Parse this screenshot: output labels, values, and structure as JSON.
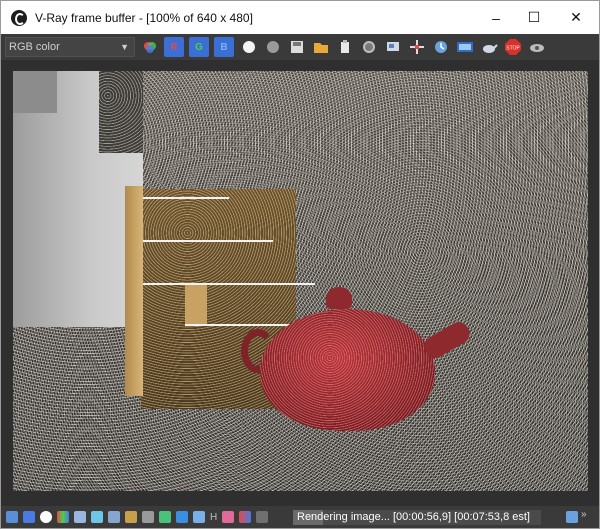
{
  "window": {
    "title": "V-Ray frame buffer - [100% of 640 x 480]",
    "minimize_glyph": "–",
    "maximize_glyph": "☐",
    "close_glyph": "✕"
  },
  "toolbar": {
    "channel_value": "RGB color",
    "red_label": "R",
    "green_label": "G",
    "blue_label": "B",
    "stop_label": "STOP",
    "icons": [
      "color-wheel-icon",
      "red-channel-icon",
      "green-channel-icon",
      "blue-channel-icon",
      "white-circle-icon",
      "gray-circle-icon",
      "save-icon",
      "folder-icon",
      "clear-icon",
      "lens-icon",
      "region-icon",
      "pan-icon",
      "history-icon",
      "vfb-icon",
      "teapot-icon",
      "stop-icon",
      "settings-icon"
    ]
  },
  "statusbar": {
    "h_label": "H",
    "status_text": "Rendering image... [00:00:56,9] [00:07:53,8 est]",
    "progress": 0.12
  },
  "colors": {
    "chrome": "#3a3a3a",
    "channel_red": "#3b6fd6",
    "channel_green": "#3b6fd6",
    "channel_blue": "#3b6fd6",
    "stop_red": "#d9302a",
    "teapot": "#b7343a"
  }
}
